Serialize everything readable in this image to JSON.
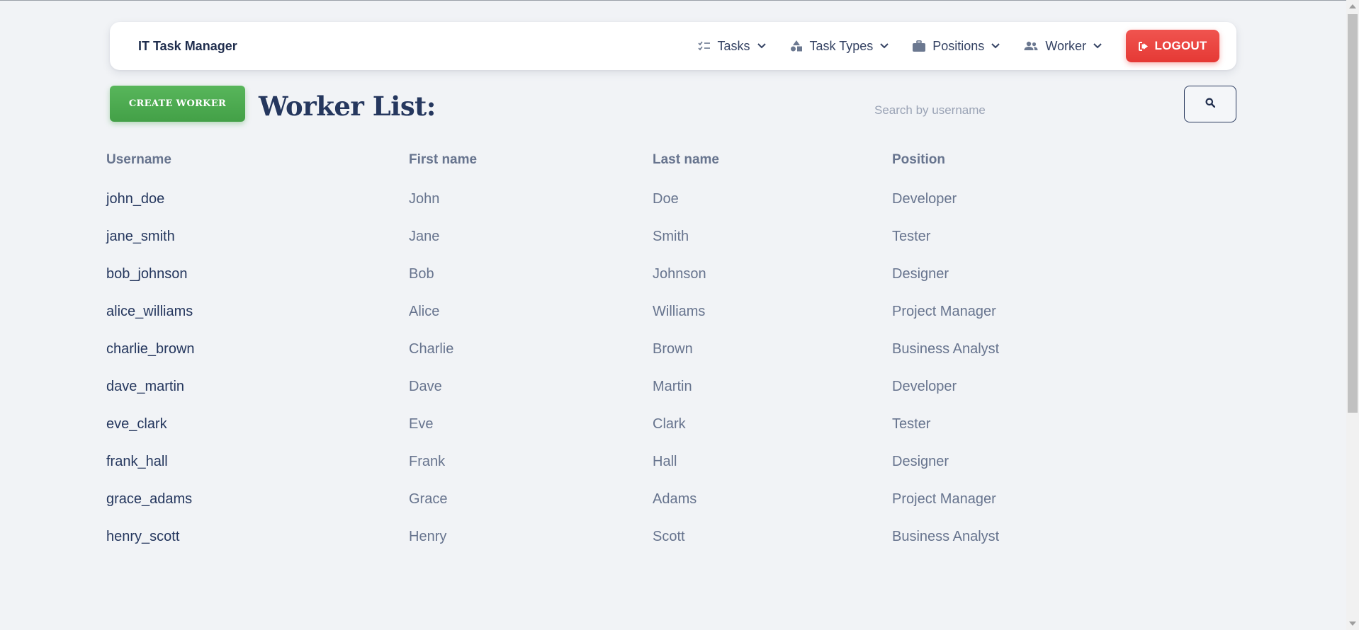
{
  "navbar": {
    "brand": "IT Task Manager",
    "items": [
      {
        "label": "Tasks",
        "icon": "task-list-icon"
      },
      {
        "label": "Task Types",
        "icon": "shapes-icon"
      },
      {
        "label": "Positions",
        "icon": "briefcase-icon"
      },
      {
        "label": "Worker",
        "icon": "users-icon"
      }
    ],
    "logout_label": "LOGOUT"
  },
  "toolbar": {
    "create_label": "CREATE WORKER",
    "title": "Worker List:",
    "search_placeholder": "Search by username",
    "search_value": ""
  },
  "table": {
    "columns": [
      "Username",
      "First name",
      "Last name",
      "Position"
    ],
    "rows": [
      [
        "john_doe",
        "John",
        "Doe",
        "Developer"
      ],
      [
        "jane_smith",
        "Jane",
        "Smith",
        "Tester"
      ],
      [
        "bob_johnson",
        "Bob",
        "Johnson",
        "Designer"
      ],
      [
        "alice_williams",
        "Alice",
        "Williams",
        "Project Manager"
      ],
      [
        "charlie_brown",
        "Charlie",
        "Brown",
        "Business Analyst"
      ],
      [
        "dave_martin",
        "Dave",
        "Martin",
        "Developer"
      ],
      [
        "eve_clark",
        "Eve",
        "Clark",
        "Tester"
      ],
      [
        "frank_hall",
        "Frank",
        "Hall",
        "Designer"
      ],
      [
        "grace_adams",
        "Grace",
        "Adams",
        "Project Manager"
      ],
      [
        "henry_scott",
        "Henry",
        "Scott",
        "Business Analyst"
      ]
    ]
  },
  "colors": {
    "background": "#f1f3f6",
    "primary_text": "#25375e",
    "muted_text": "#67748e",
    "logout_red": "#e53935",
    "create_green": "#43a047"
  }
}
